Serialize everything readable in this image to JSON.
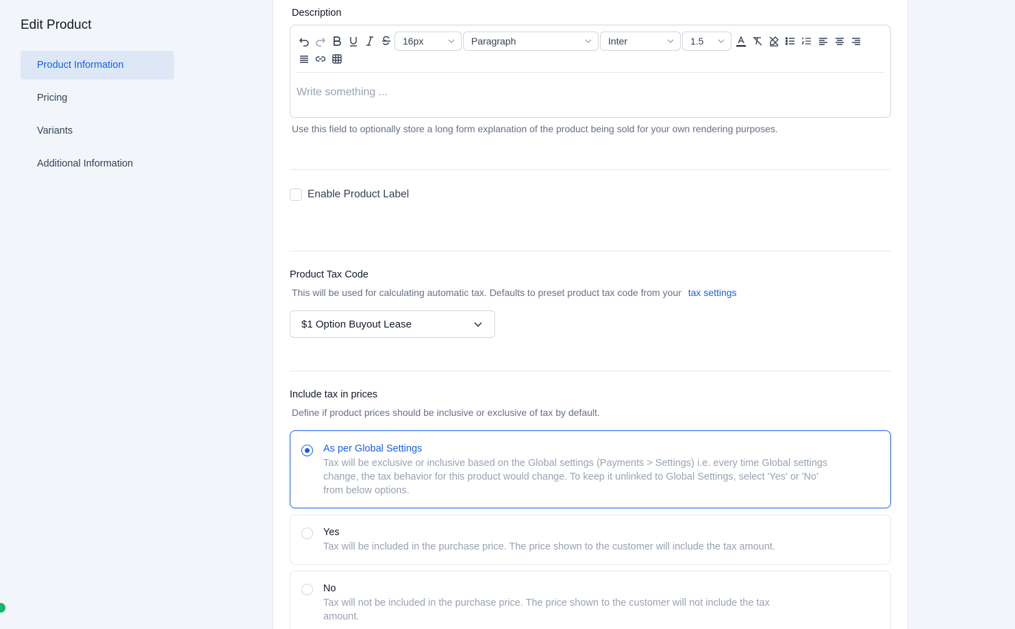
{
  "sidebar": {
    "title": "Edit Product",
    "items": [
      {
        "label": "Product Information"
      },
      {
        "label": "Pricing"
      },
      {
        "label": "Variants"
      },
      {
        "label": "Additional Information"
      }
    ]
  },
  "description": {
    "label": "Description",
    "toolbar": {
      "font_size": "16px",
      "block_type": "Paragraph",
      "font_family": "Inter",
      "line_height": "1.5"
    },
    "placeholder": "Write something ...",
    "helper": "Use this field to optionally store a long form explanation of the product being sold for your own rendering purposes."
  },
  "product_label": {
    "checkbox_label": "Enable Product Label",
    "checked": false
  },
  "tax_code": {
    "label": "Product Tax Code",
    "helper": "This will be used for calculating automatic tax. Defaults to preset product tax code from your",
    "helper_link": "tax settings",
    "selected_value": "$1 Option Buyout Lease"
  },
  "include_tax": {
    "label": "Include tax in prices",
    "helper": "Define if product prices should be inclusive or exclusive of tax by default.",
    "options": [
      {
        "title": "As per Global Settings",
        "desc": "Tax will be exclusive or inclusive based on the Global settings (Payments > Settings) i.e. every time Global settings change, the tax behavior for this product would change. To keep it unlinked to Global Settings, select 'Yes' or 'No' from below options.",
        "selected": true
      },
      {
        "title": "Yes",
        "desc": "Tax will be included in the purchase price. The price shown to the customer will include the tax amount.",
        "selected": false
      },
      {
        "title": "No",
        "desc": "Tax will not be included in the purchase price. The price shown to the customer will not include the tax amount.",
        "selected": false
      }
    ]
  },
  "colors": {
    "accent": "#155eef",
    "sidebar_bg": "#f2f6fb",
    "active_nav_bg": "#dde7f6"
  }
}
